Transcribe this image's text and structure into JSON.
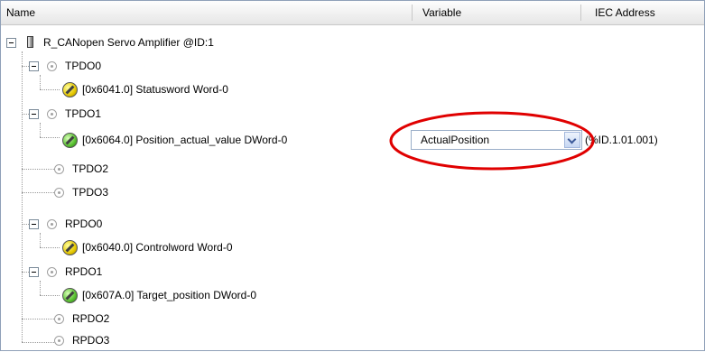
{
  "columns": {
    "name": "Name",
    "variable": "Variable",
    "iec_address": "IEC Address"
  },
  "tree": {
    "device": "R_CANopen Servo Amplifier @ID:1",
    "tpdo0": {
      "label": "TPDO0",
      "object": "[0x6041.0] Statusword Word-0"
    },
    "tpdo1": {
      "label": "TPDO1",
      "object": "[0x6064.0] Position_actual_value DWord-0",
      "variable": "ActualPosition",
      "iec_address": "(%ID.1.01.001)"
    },
    "tpdo2": {
      "label": "TPDO2"
    },
    "tpdo3": {
      "label": "TPDO3"
    },
    "rpdo0": {
      "label": "RPDO0",
      "object": "[0x6040.0] Controlword Word-0"
    },
    "rpdo1": {
      "label": "RPDO1",
      "object": "[0x607A.0] Target_position DWord-0"
    },
    "rpdo2": {
      "label": "RPDO2"
    },
    "rpdo3": {
      "label": "RPDO3"
    }
  },
  "colors": {
    "header_border": "#c8c8c8",
    "highlight_ellipse": "#e00000",
    "status_yellow": "#e6c800",
    "status_green": "#58c030"
  },
  "icons": {
    "device": "device-module-icon",
    "pdo": "pdo-circle-icon",
    "object_yellow": "object-status-yellow-icon",
    "object_green": "object-status-green-icon",
    "dropdown": "chevron-down-icon"
  }
}
